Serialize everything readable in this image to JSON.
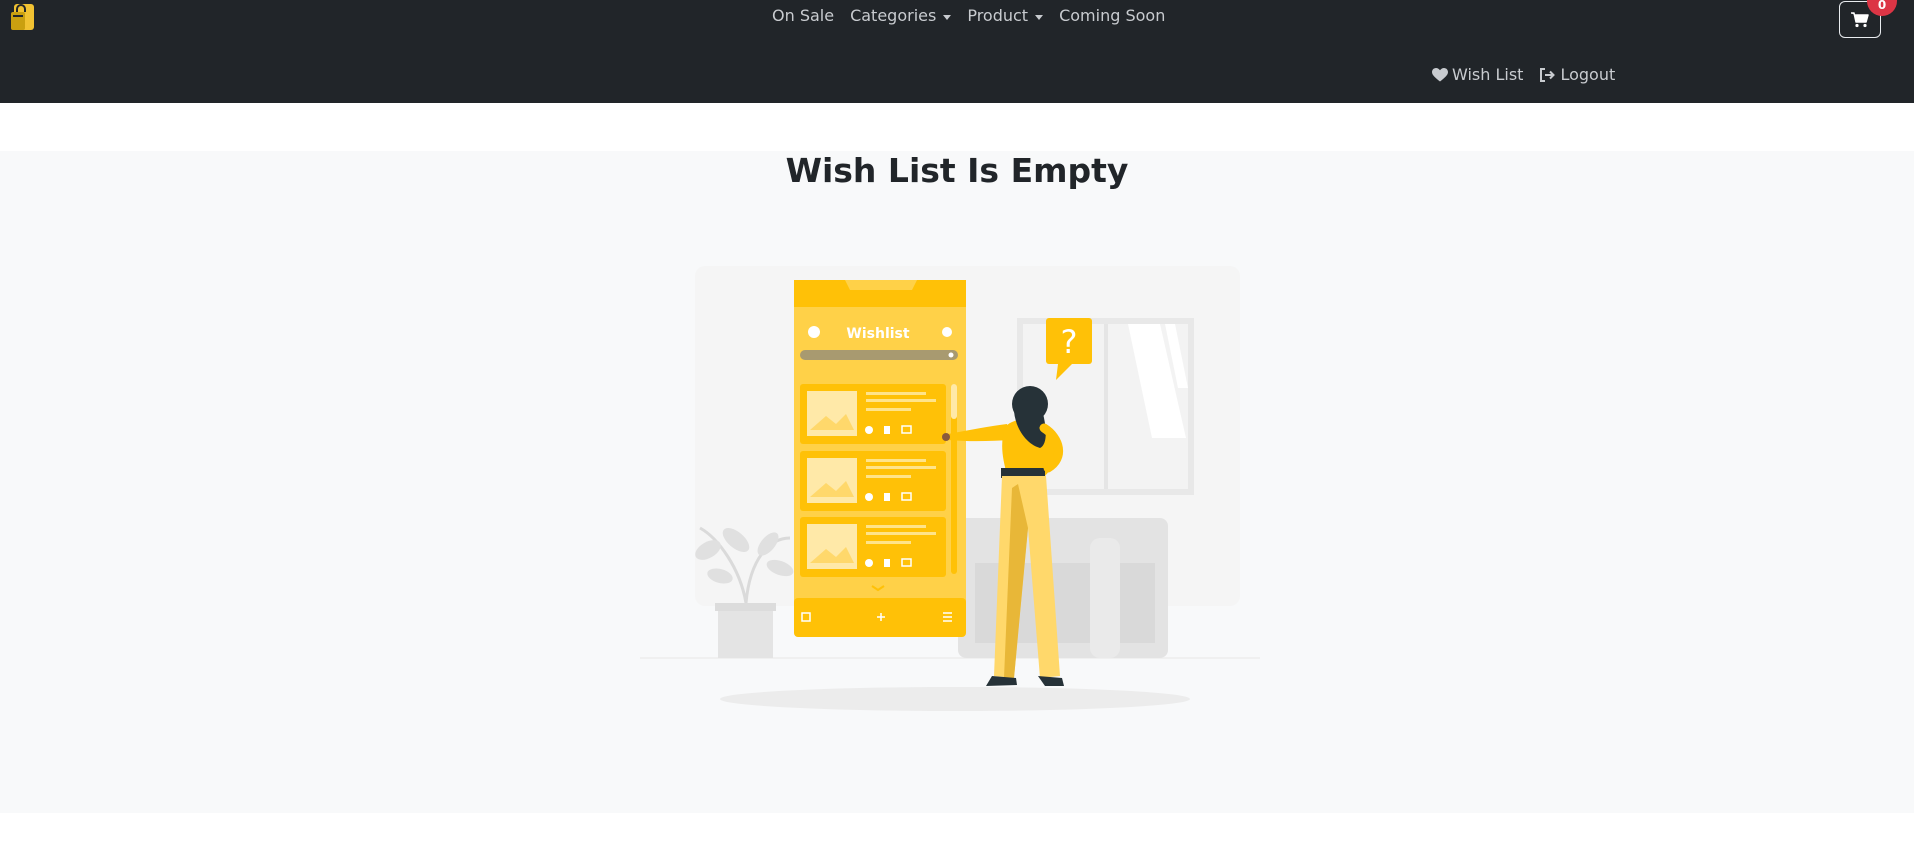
{
  "navbar": {
    "links": [
      {
        "label": "On Sale"
      },
      {
        "label": "Categories"
      },
      {
        "label": "Product"
      },
      {
        "label": "Coming Soon"
      }
    ],
    "cart_count": "0",
    "wishlist_label": "Wish List",
    "logout_label": "Logout"
  },
  "main": {
    "title": "Wish List Is Empty"
  },
  "illustration": {
    "screen_title": "Wishlist",
    "question_mark": "?"
  },
  "colors": {
    "navbar": "#212529",
    "accent": "#FFC107",
    "badge": "#dc3545",
    "page_bg": "#f8f9fa"
  }
}
